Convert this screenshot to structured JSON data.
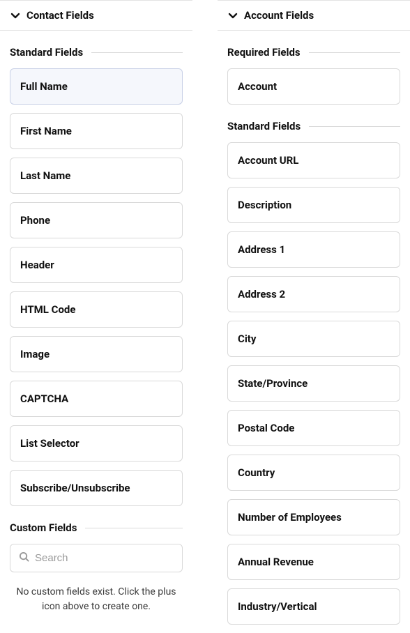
{
  "contact": {
    "header": "Contact Fields",
    "standardHeading": "Standard Fields",
    "standardFields": [
      {
        "label": "Full Name",
        "selected": true
      },
      {
        "label": "First Name",
        "selected": false
      },
      {
        "label": "Last Name",
        "selected": false
      },
      {
        "label": "Phone",
        "selected": false
      },
      {
        "label": "Header",
        "selected": false
      },
      {
        "label": "HTML Code",
        "selected": false
      },
      {
        "label": "Image",
        "selected": false
      },
      {
        "label": "CAPTCHA",
        "selected": false
      },
      {
        "label": "List Selector",
        "selected": false
      },
      {
        "label": "Subscribe/Unsubscribe",
        "selected": false
      }
    ],
    "customHeading": "Custom Fields",
    "searchPlaceholder": "Search",
    "emptyMessage": "No custom fields exist. Click the plus icon above to create one."
  },
  "account": {
    "header": "Account Fields",
    "requiredHeading": "Required Fields",
    "requiredFields": [
      {
        "label": "Account"
      }
    ],
    "standardHeading": "Standard Fields",
    "standardFields": [
      {
        "label": "Account URL"
      },
      {
        "label": "Description"
      },
      {
        "label": "Address 1"
      },
      {
        "label": "Address 2"
      },
      {
        "label": "City"
      },
      {
        "label": "State/Province"
      },
      {
        "label": "Postal Code"
      },
      {
        "label": "Country"
      },
      {
        "label": "Number of Employees"
      },
      {
        "label": "Annual Revenue"
      },
      {
        "label": "Industry/Vertical"
      }
    ]
  }
}
